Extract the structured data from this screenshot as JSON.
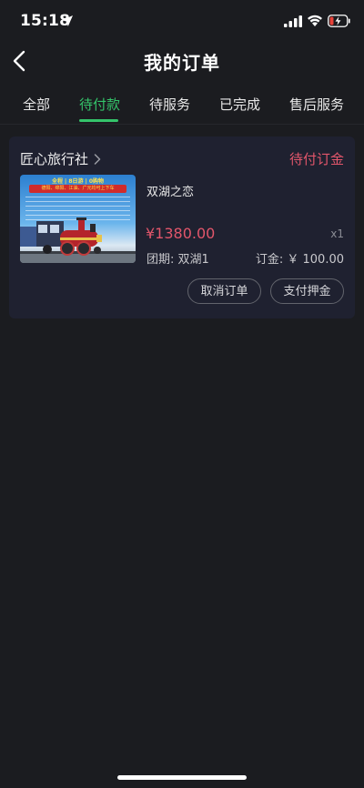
{
  "status_bar": {
    "time": "15:18",
    "location_icon": "location-arrow-icon",
    "signal_icon": "cellular-signal-icon",
    "wifi_icon": "wifi-icon",
    "battery_icon": "battery-low-charging-icon"
  },
  "nav": {
    "back_icon": "chevron-left-icon",
    "title": "我的订单"
  },
  "tabs": [
    {
      "label": "全部",
      "active": false
    },
    {
      "label": "待付款",
      "active": true
    },
    {
      "label": "待服务",
      "active": false
    },
    {
      "label": "已完成",
      "active": false
    },
    {
      "label": "售后服务",
      "active": false
    }
  ],
  "order": {
    "agency": "匠心旅行社",
    "status": "待付订金",
    "product": {
      "name": "双湖之恋",
      "price": "¥1380.00",
      "quantity": "x1",
      "group_date": "团期: 双湖1",
      "deposit": "订金: ￥ 100.00",
      "thumbnail": {
        "banner_text": "全程 | 8日游 | 0购物",
        "ribbon_text": "德阳、绵阳、江油、广元均可上下车"
      }
    },
    "buttons": {
      "cancel": "取消订单",
      "pay": "支付押金"
    }
  },
  "colors": {
    "background": "#1b1c20",
    "card": "#1f2130",
    "accent_green": "#34c46a",
    "price_red": "#e2566b"
  }
}
